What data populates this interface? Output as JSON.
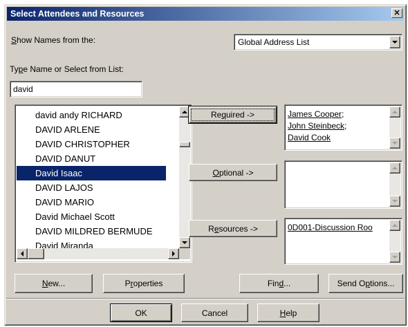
{
  "dialog": {
    "title": "Select Attendees and Resources",
    "close_glyph": "×"
  },
  "show_names": {
    "label_prefix": "",
    "label_mnemonic": "S",
    "label_rest": "how Names from the:",
    "selected_value": "Global Address List"
  },
  "type_name": {
    "label_pre": "Ty",
    "label_mnemonic": "p",
    "label_rest": "e Name or Select from List:",
    "value": "david"
  },
  "name_list": {
    "items": [
      "david andy RICHARD",
      "DAVID ARLENE",
      "DAVID CHRISTOPHER",
      "DAVID DANUT",
      "David Isaac",
      "DAVID LAJOS",
      "DAVID MARIO",
      "David Michael Scott",
      "DAVID MILDRED BERMUDE",
      "David Miranda"
    ],
    "selected_index": 4
  },
  "buttons": {
    "required_pre": "Re",
    "required_mnemonic": "q",
    "required_rest": "uired ->",
    "optional_mnemonic": "O",
    "optional_rest": "ptional ->",
    "resources_pre": "R",
    "resources_mnemonic": "e",
    "resources_rest": "sources ->",
    "new_mnemonic": "N",
    "new_rest": "ew...",
    "properties_pre": "P",
    "properties_mnemonic": "r",
    "properties_rest": "operties",
    "find_pre": "Fin",
    "find_mnemonic": "d",
    "find_rest": "...",
    "send_options_pre": "Send O",
    "send_options_mnemonic": "p",
    "send_options_rest": "tions...",
    "ok": "OK",
    "cancel": "Cancel",
    "help_mnemonic": "H",
    "help_rest": "elp"
  },
  "required_recipients": [
    "James Cooper;",
    "John Steinbeck;",
    "David Cook"
  ],
  "optional_recipients": [],
  "resource_recipients": [
    "0D001-Discussion Roo"
  ]
}
